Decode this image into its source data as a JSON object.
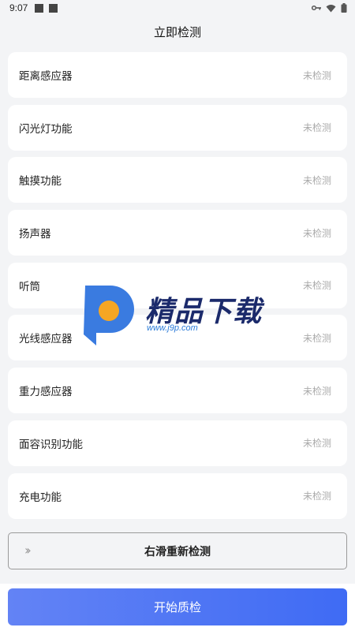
{
  "status": {
    "time": "9:07"
  },
  "header": {
    "title": "立即检测"
  },
  "items": [
    {
      "name": "距离感应器",
      "status": "未检测"
    },
    {
      "name": "闪光灯功能",
      "status": "未检测"
    },
    {
      "name": "触摸功能",
      "status": "未检测"
    },
    {
      "name": "扬声器",
      "status": "未检测"
    },
    {
      "name": "听筒",
      "status": "未检测"
    },
    {
      "name": "光线感应器",
      "status": "未检测"
    },
    {
      "name": "重力感应器",
      "status": "未检测"
    },
    {
      "name": "面容识别功能",
      "status": "未检测"
    },
    {
      "name": "充电功能",
      "status": "未检测"
    }
  ],
  "slider": {
    "label": "右滑重新检测",
    "arrows": "››"
  },
  "start_button": {
    "label": "开始质检"
  },
  "watermark": {
    "title": "精品下载",
    "url": "www.j9p.com"
  },
  "colors": {
    "accent": "#4a73f5",
    "background": "#f3f4f6",
    "muted": "#aaaaaa"
  }
}
